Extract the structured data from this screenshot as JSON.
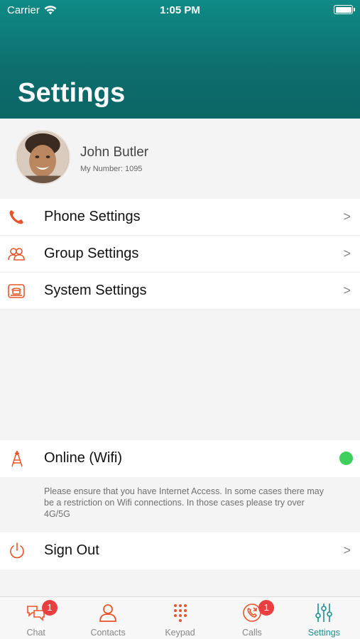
{
  "status_bar": {
    "carrier": "Carrier",
    "time": "1:05 PM"
  },
  "header": {
    "title": "Settings"
  },
  "profile": {
    "name": "John Butler",
    "number": "My Number: 1095"
  },
  "menu": [
    {
      "label": "Phone Settings",
      "icon": "phone-icon",
      "chevron": ">"
    },
    {
      "label": "Group Settings",
      "icon": "group-icon",
      "chevron": ">"
    },
    {
      "label": "System Settings",
      "icon": "system-icon",
      "chevron": ">"
    }
  ],
  "connection": {
    "label": "Online (Wifi)",
    "icon": "antenna-icon",
    "status_color": "#3fcf5c",
    "notice": "Please ensure that you have Internet Access. In some cases there may be a restriction on Wifi connections. In those cases please try over 4G/5G"
  },
  "signout": {
    "label": "Sign Out",
    "icon": "power-icon",
    "chevron": ">"
  },
  "tabs": [
    {
      "label": "Chat",
      "icon": "chat-icon",
      "badge": "1"
    },
    {
      "label": "Contacts",
      "icon": "contacts-icon",
      "badge": ""
    },
    {
      "label": "Keypad",
      "icon": "keypad-icon",
      "badge": ""
    },
    {
      "label": "Calls",
      "icon": "calls-icon",
      "badge": "1"
    },
    {
      "label": "Settings",
      "icon": "settings-sliders-icon",
      "badge": "",
      "active": true
    }
  ],
  "colors": {
    "accent": "#e8552a",
    "teal": "#0d6e6d",
    "active_tab": "#1b8f93",
    "badge": "#e84040"
  }
}
